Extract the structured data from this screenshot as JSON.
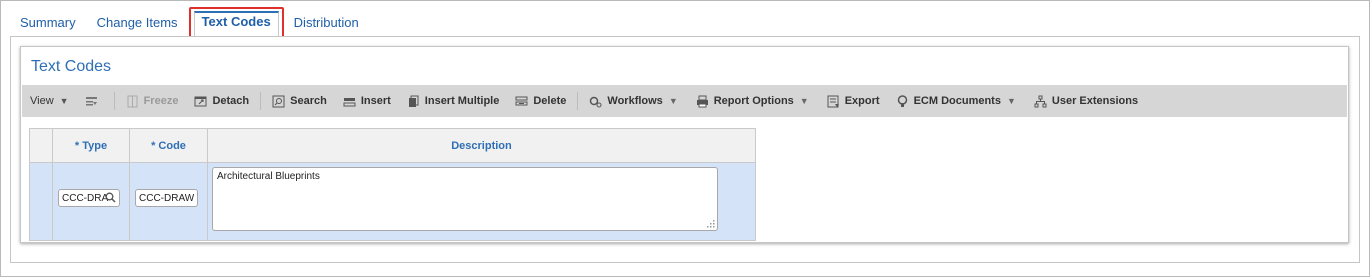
{
  "tabs": [
    {
      "label": "Summary"
    },
    {
      "label": "Change Items"
    },
    {
      "label": "Text Codes",
      "active": true
    },
    {
      "label": "Distribution"
    }
  ],
  "panel": {
    "title": "Text Codes"
  },
  "toolbar": {
    "view": "View",
    "freeze": "Freeze",
    "detach": "Detach",
    "search": "Search",
    "insert": "Insert",
    "insert_multiple": "Insert Multiple",
    "delete": "Delete",
    "workflows": "Workflows",
    "report_options": "Report Options",
    "export": "Export",
    "ecm_documents": "ECM Documents",
    "user_extensions": "User Extensions"
  },
  "grid": {
    "columns": [
      "* Type",
      "* Code",
      "Description"
    ],
    "rows": [
      {
        "type": "CCC-DRA",
        "code": "CCC-DRAW",
        "description": "Architectural Blueprints"
      }
    ]
  },
  "colors": {
    "accent": "#2f6fb6",
    "highlight": "#e0302c",
    "row": "#d4e3f7",
    "toolbar": "#d6d6d6"
  }
}
